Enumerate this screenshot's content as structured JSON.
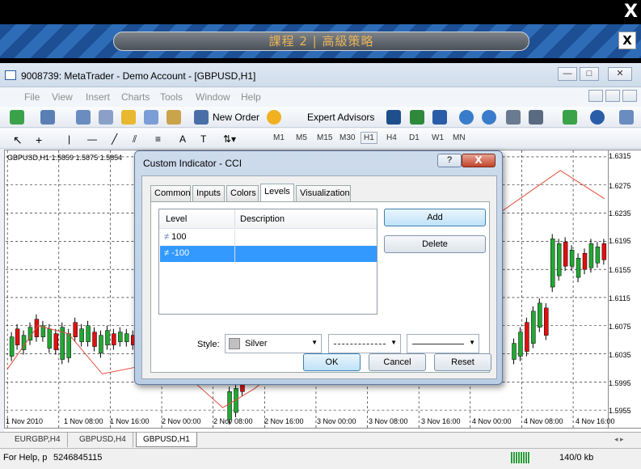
{
  "overlay": {
    "close": "X"
  },
  "banner": {
    "title": "課程 2 | 高級策略",
    "close": "X"
  },
  "window": {
    "title": "9008739: MetaTrader - Demo Account - [GBPUSD,H1]",
    "min": "—",
    "max": "□",
    "close": "✕"
  },
  "menu": [
    "File",
    "View",
    "Insert",
    "Charts",
    "Tools",
    "Window",
    "Help"
  ],
  "toolbar": {
    "new_order": "New Order",
    "expert_advisors": "Expert Advisors"
  },
  "timeframes": [
    "M1",
    "M5",
    "M15",
    "M30",
    "H1",
    "H4",
    "D1",
    "W1",
    "MN"
  ],
  "chart": {
    "info": "GBPUSD,H1  1.5859 1.5875 1.5854",
    "prices": [
      "1.6315",
      "1.6275",
      "1.6235",
      "1.6195",
      "1.6155",
      "1.6115",
      "1.6075",
      "1.6035",
      "1.5995",
      "1.5955"
    ],
    "times": [
      "1 Nov 2010",
      "1 Nov 08:00",
      "1 Nov 16:00",
      "2 Nov 00:00",
      "2 Nov 08:00",
      "2 Nov 16:00",
      "3 Nov 00:00",
      "3 Nov 08:00",
      "3 Nov 16:00",
      "4 Nov 00:00",
      "4 Nov 08:00",
      "4 Nov 16:00"
    ]
  },
  "chart_tabs": [
    "EURGBP,H4",
    "GBPUSD,H4",
    "GBPUSD,H1"
  ],
  "status": {
    "help": "For Help, p",
    "number": "5246845115",
    "kb": "140/0 kb"
  },
  "dialog": {
    "title": "Custom Indicator - CCI",
    "help": "?",
    "close": "X",
    "tabs": [
      "Common",
      "Inputs",
      "Colors",
      "Levels",
      "Visualization"
    ],
    "columns": [
      "Level",
      "Description"
    ],
    "levels": [
      {
        "value": "100"
      },
      {
        "value": "-100"
      }
    ],
    "add": "Add",
    "delete": "Delete",
    "style_label": "Style:",
    "style_color": "Silver",
    "ok": "OK",
    "cancel": "Cancel",
    "reset": "Reset"
  },
  "colors": {
    "selected": "#3399ff",
    "candle_up": "#22a833",
    "candle_down": "#e01010",
    "zigzag": "#e24a3a"
  }
}
